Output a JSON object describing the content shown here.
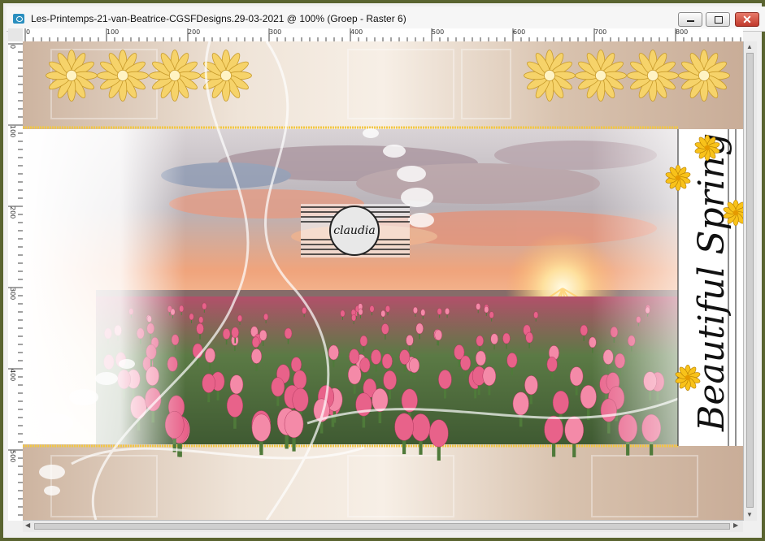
{
  "window": {
    "title": "Les-Printemps-21-van-Beatrice-CGSFDesigns.29-03-2021 @ 100% (Groep - Raster 6)",
    "close_label": "✕"
  },
  "ruler": {
    "top_labels": [
      "0",
      "100",
      "200",
      "300",
      "400",
      "500",
      "600",
      "700",
      "800"
    ],
    "left_labels": [
      "0",
      "100",
      "200",
      "300",
      "400",
      "500"
    ]
  },
  "artwork": {
    "watermark_text": "claudia",
    "script_text": "Beautiful Spring"
  },
  "colors": {
    "window_border": "#5a6430",
    "beige": "#dcc8b6",
    "gold": "#f2c744",
    "tulip_pink": "#e8628a",
    "sky_orange": "#f0a070"
  },
  "icons": {
    "app": "paint-app-icon",
    "minimize": "minimize-icon",
    "maximize": "maximize-icon",
    "close": "close-icon"
  }
}
